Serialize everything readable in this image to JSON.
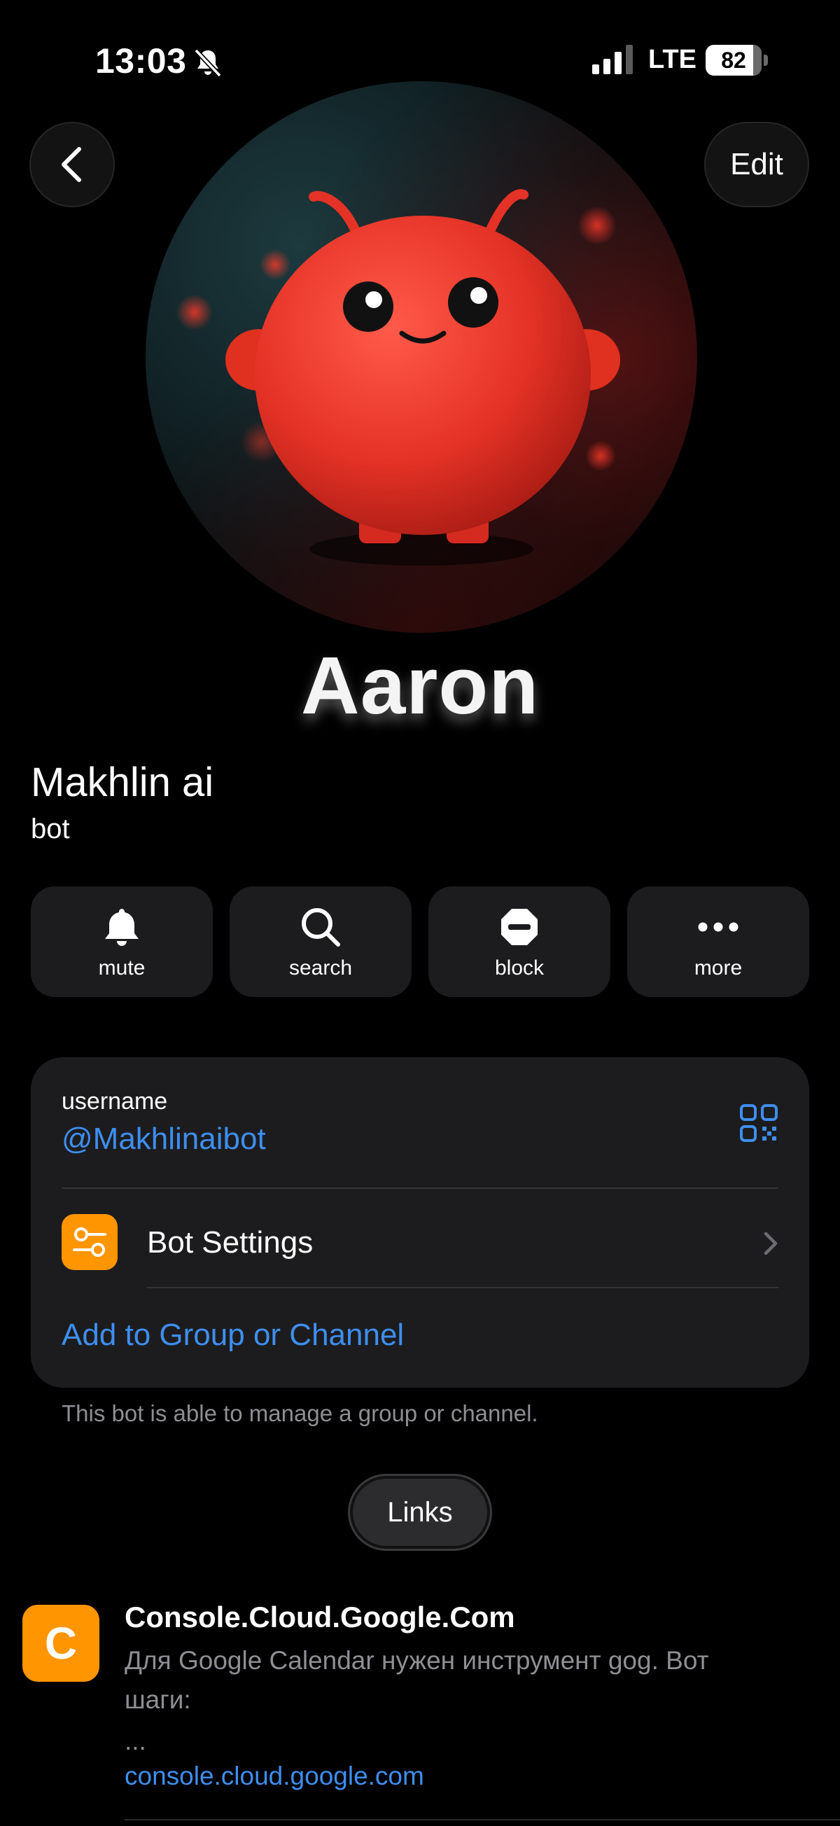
{
  "status_bar": {
    "time": "13:03",
    "network": "LTE",
    "battery": "82"
  },
  "header": {
    "edit_label": "Edit"
  },
  "profile": {
    "brand_text": "Aaron",
    "name": "Makhlin ai",
    "subtitle": "bot"
  },
  "actions": [
    {
      "label": "mute",
      "icon": "bell-icon"
    },
    {
      "label": "search",
      "icon": "search-icon"
    },
    {
      "label": "block",
      "icon": "block-icon"
    },
    {
      "label": "more",
      "icon": "ellipsis-icon"
    }
  ],
  "info": {
    "username_label": "username",
    "username_value": "@Makhlinaibot",
    "settings_label": "Bot Settings",
    "add_label": "Add to Group or Channel",
    "footnote": "This bot is able to manage a group or channel."
  },
  "links_tab": "Links",
  "link_item": {
    "avatar_letter": "C",
    "title": "Console.Cloud.Google.Com",
    "description": "Для Google Calendar нужен инструмент gog. Вот шаги:",
    "ellipsis": "...",
    "url": "console.cloud.google.com"
  },
  "colors": {
    "accent": "#3e8ef0",
    "orange": "#ff9500",
    "card": "#1c1c1e",
    "background": "#000000"
  }
}
